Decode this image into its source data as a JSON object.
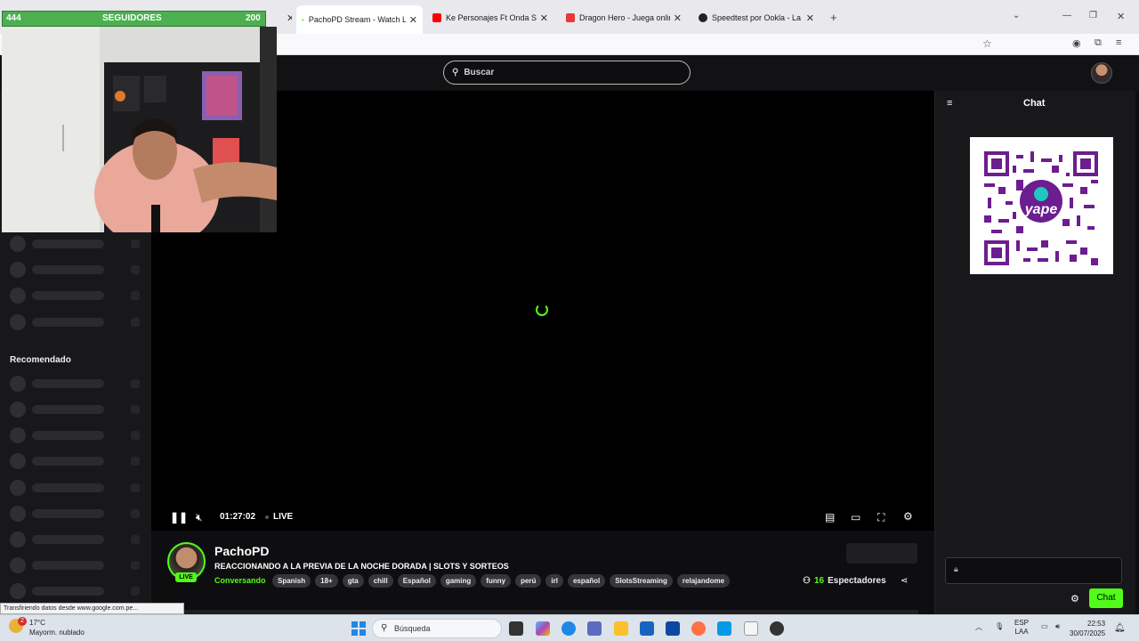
{
  "browser": {
    "tabs": [
      {
        "title": "PachoPD Stream - Watch Live o",
        "active": true,
        "icon": "kick-icon"
      },
      {
        "title": "Ke Personajes Ft Onda Sabaner",
        "active": false,
        "icon": "youtube-icon"
      },
      {
        "title": "Dragon Hero - Juega online | Bu",
        "active": false,
        "icon": "game-icon"
      },
      {
        "title": "Speedtest por Ookla - La prueb",
        "active": false,
        "icon": "speedtest-icon"
      }
    ]
  },
  "header": {
    "search_placeholder": "Buscar"
  },
  "sidebar": {
    "recommended_label": "Recomendado"
  },
  "player": {
    "time": "01:27:02",
    "live_label": "LIVE"
  },
  "stream": {
    "streamer_name": "PachoPD",
    "live_badge": "LIVE",
    "title": "REACCIONANDO A LA PREVIA DE LA NOCHE DORADA | SLOTS Y SORTEOS",
    "category": "Conversando",
    "tags": [
      "Spanish",
      "18+",
      "gta",
      "chill",
      "Español",
      "gaming",
      "funny",
      "perú",
      "irl",
      "español",
      "SlotsStreaming",
      "relajandome"
    ],
    "viewers_count": "16",
    "viewers_label": "Espectadores"
  },
  "chat": {
    "title": "Chat",
    "send_label": "Chat",
    "qr_brand": "yape"
  },
  "overlay": {
    "followers_current": "444",
    "followers_label": "SEGUIDORES",
    "followers_goal": "200"
  },
  "status_tip": "Transfiriendo datos desde www.google.com.pe...",
  "taskbar": {
    "weather_badge": "2",
    "temperature": "17°C",
    "weather_desc": "Mayorm. nublado",
    "search_placeholder": "Búsqueda",
    "language": "ESP",
    "layout": "LAA",
    "time": "22:53",
    "date": "30/07/2025"
  },
  "colors": {
    "accent": "#53fc18",
    "page_bg": "#0e0e10",
    "sidebar_bg": "#18181b",
    "follower_bar": "#4caf50",
    "qr_purple": "#6c1d8f"
  }
}
